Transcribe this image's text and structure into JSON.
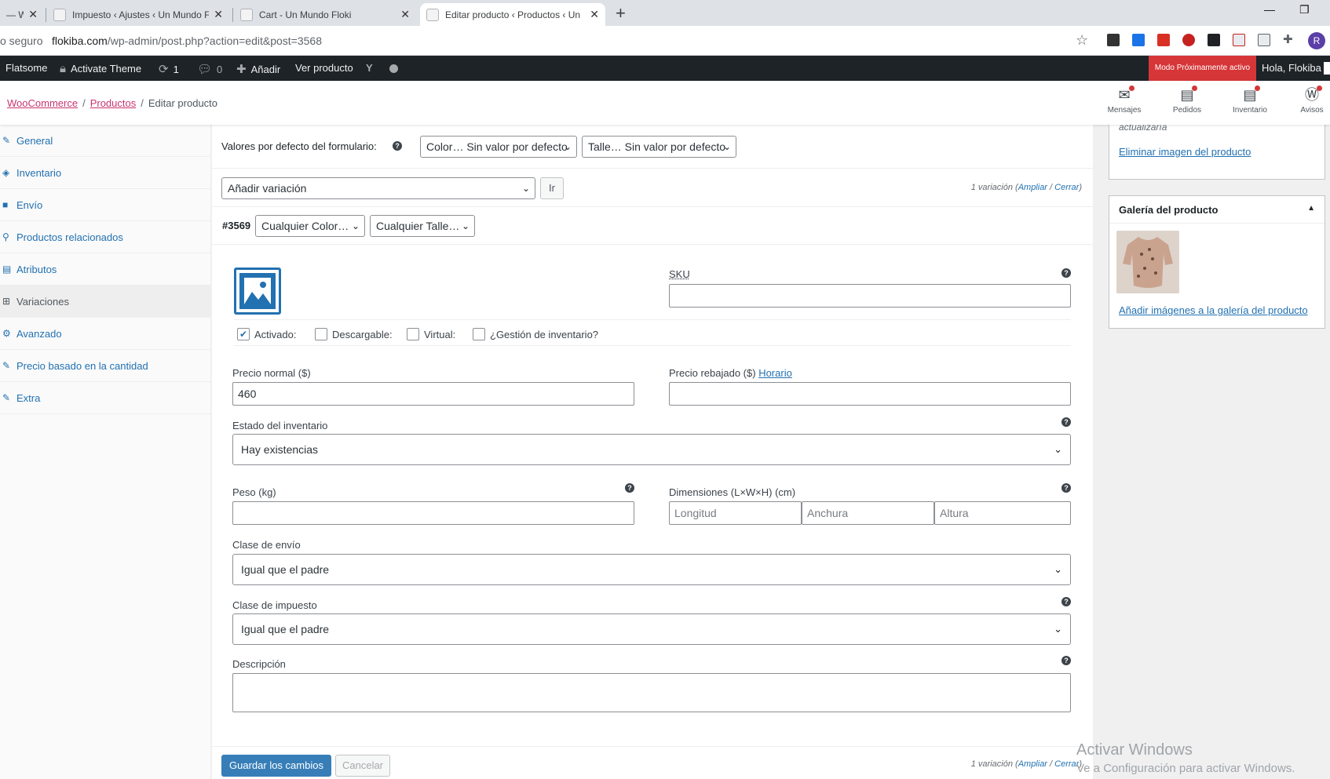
{
  "browser": {
    "tabs": [
      {
        "title": "— W"
      },
      {
        "title": "Impuesto ‹ Ajustes ‹ Un Mundo F"
      },
      {
        "title": "Cart - Un Mundo Floki"
      },
      {
        "title": "Editar producto ‹ Productos ‹ Un"
      }
    ],
    "new_tab": "+",
    "address": {
      "security": "o seguro",
      "domain": "flokiba.com",
      "path": "/wp-admin/post.php?action=edit&post=3568"
    },
    "profile_initial": "R"
  },
  "adminbar": {
    "site": "Flatsome",
    "activate_theme": "Activate Theme",
    "updates_count": "1",
    "comments_count": "0",
    "add_new": "Añadir",
    "view_product": "Ver producto",
    "coming_soon": "Modo Próximamente activo",
    "greeting": "Hola, Flokiba"
  },
  "wc_header": {
    "breadcrumb": [
      "WooCommerce",
      "Productos",
      "Editar producto"
    ],
    "actions": [
      {
        "label": "Mensajes",
        "icon": "mail-icon"
      },
      {
        "label": "Pedidos",
        "icon": "orders-icon"
      },
      {
        "label": "Inventario",
        "icon": "inventory-icon"
      },
      {
        "label": "Avisos",
        "icon": "wordpress-icon"
      }
    ]
  },
  "product_tabs": [
    {
      "label": "General",
      "icon": "wrench-icon"
    },
    {
      "label": "Inventario",
      "icon": "tag-icon"
    },
    {
      "label": "Envío",
      "icon": "truck-icon"
    },
    {
      "label": "Productos relacionados",
      "icon": "link-icon"
    },
    {
      "label": "Atributos",
      "icon": "list-icon"
    },
    {
      "label": "Variaciones",
      "icon": "grid-icon"
    },
    {
      "label": "Avanzado",
      "icon": "gear-icon"
    },
    {
      "label": "Precio basado en la cantidad",
      "icon": "wrench-icon"
    },
    {
      "label": "Extra",
      "icon": "wrench-icon"
    }
  ],
  "variations": {
    "defaults_label": "Valores por defecto del formulario:",
    "default_color": "Color… Sin valor por defecto",
    "default_size": "Talle… Sin valor por defecto",
    "add_variation": "Añadir variación",
    "go_button": "Ir",
    "count_text": "1 variación",
    "expand": "Ampliar",
    "slash": " / ",
    "close": "Cerrar",
    "variation_id": "#3569",
    "any_color": "Cualquier Color…",
    "any_size": "Cualquier Talle…"
  },
  "form": {
    "sku_label": "SKU",
    "sku_value": "",
    "enabled_label": "Activado:",
    "downloadable_label": "Descargable:",
    "virtual_label": "Virtual:",
    "manage_stock_label": "¿Gestión de inventario?",
    "regular_price_label": "Precio normal ($)",
    "regular_price_value": "460",
    "sale_price_label": "Precio rebajado ($)",
    "schedule_link": "Horario",
    "stock_status_label": "Estado del inventario",
    "stock_status_value": "Hay existencias",
    "weight_label": "Peso (kg)",
    "dimensions_label": "Dimensiones (L×W×H) (cm)",
    "length_placeholder": "Longitud",
    "width_placeholder": "Anchura",
    "height_placeholder": "Altura",
    "shipping_class_label": "Clase de envío",
    "shipping_class_value": "Igual que el padre",
    "tax_class_label": "Clase de impuesto",
    "tax_class_value": "Igual que el padre",
    "description_label": "Descripción"
  },
  "footer": {
    "save": "Guardar los cambios",
    "cancel": "Cancelar"
  },
  "sidebar": {
    "truncated_note": "actualizaría",
    "remove_image": "Eliminar imagen del producto",
    "gallery_title": "Galería del producto",
    "add_gallery_images": "Añadir imágenes a la galería del producto"
  },
  "watermark": {
    "line1": "Activar Windows",
    "line2": "Ve a Configuración para activar Windows."
  }
}
